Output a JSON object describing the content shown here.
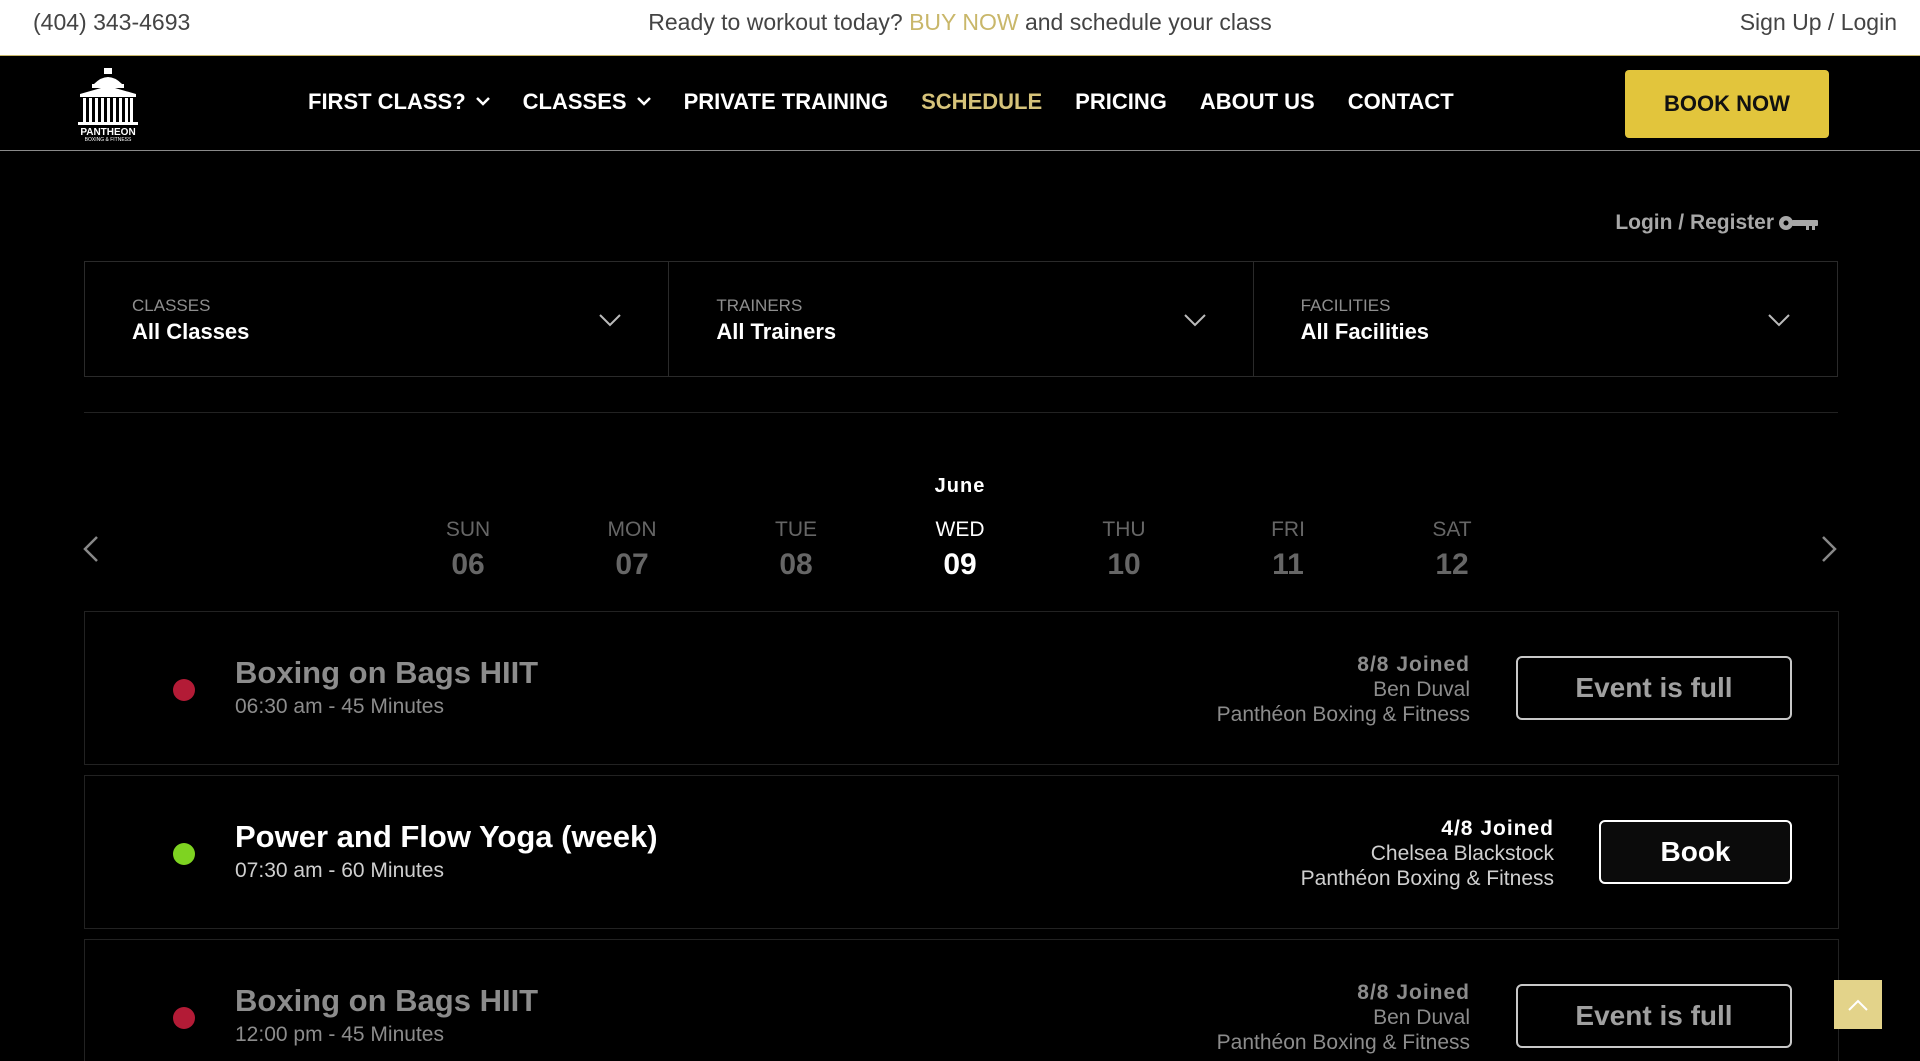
{
  "topbar": {
    "phone": "(404) 343-4693",
    "promo_before": "Ready to workout today? ",
    "promo_link": "BUY NOW",
    "promo_after": " and schedule your class",
    "auth": "Sign Up / Login"
  },
  "nav": {
    "logo_alt": "PANTHEON BOXING & FITNESS",
    "items": [
      {
        "label": "FIRST CLASS?",
        "dropdown": true
      },
      {
        "label": "CLASSES",
        "dropdown": true
      },
      {
        "label": "PRIVATE TRAINING"
      },
      {
        "label": "SCHEDULE",
        "active": true
      },
      {
        "label": "PRICING"
      },
      {
        "label": "ABOUT US"
      },
      {
        "label": "CONTACT"
      }
    ],
    "cta": "BOOK NOW"
  },
  "login_register": "Login / Register",
  "filters": [
    {
      "label": "CLASSES",
      "value": "All Classes"
    },
    {
      "label": "TRAINERS",
      "value": "All Trainers"
    },
    {
      "label": "FACILITIES",
      "value": "All Facilities"
    }
  ],
  "calendar": {
    "month": "June",
    "days": [
      {
        "name": "SUN",
        "num": "06"
      },
      {
        "name": "MON",
        "num": "07"
      },
      {
        "name": "TUE",
        "num": "08"
      },
      {
        "name": "WED",
        "num": "09",
        "active": true
      },
      {
        "name": "THU",
        "num": "10"
      },
      {
        "name": "FRI",
        "num": "11"
      },
      {
        "name": "SAT",
        "num": "12"
      }
    ]
  },
  "events": [
    {
      "title": "Boxing on Bags HIIT",
      "time": "06:30 am - 45 Minutes",
      "joined": "8/8 Joined",
      "trainer": "Ben Duval",
      "facility": "Panthéon Boxing & Fitness",
      "action": "Event is full",
      "status": "full",
      "dot_color": "#b31b36"
    },
    {
      "title": "Power and Flow Yoga (week)",
      "time": "07:30 am - 60 Minutes",
      "joined": "4/8 Joined",
      "trainer": "Chelsea Blackstock",
      "facility": "Panthéon Boxing & Fitness",
      "action": "Book",
      "status": "open",
      "dot_color": "#7ed321"
    },
    {
      "title": "Boxing on Bags HIIT",
      "time": "12:00 pm - 45 Minutes",
      "joined": "8/8 Joined",
      "trainer": "Ben Duval",
      "facility": "Panthéon Boxing & Fitness",
      "action": "Event is full",
      "status": "full",
      "dot_color": "#b31b36"
    }
  ],
  "colors": {
    "accent": "#e2c53c",
    "link": "#c9b76a",
    "active_nav": "#d6c37a"
  },
  "icons": {
    "scroll_top": "chevron-up-icon",
    "key": "key-icon",
    "prev": "chevron-left-icon",
    "next": "chevron-right-icon"
  }
}
